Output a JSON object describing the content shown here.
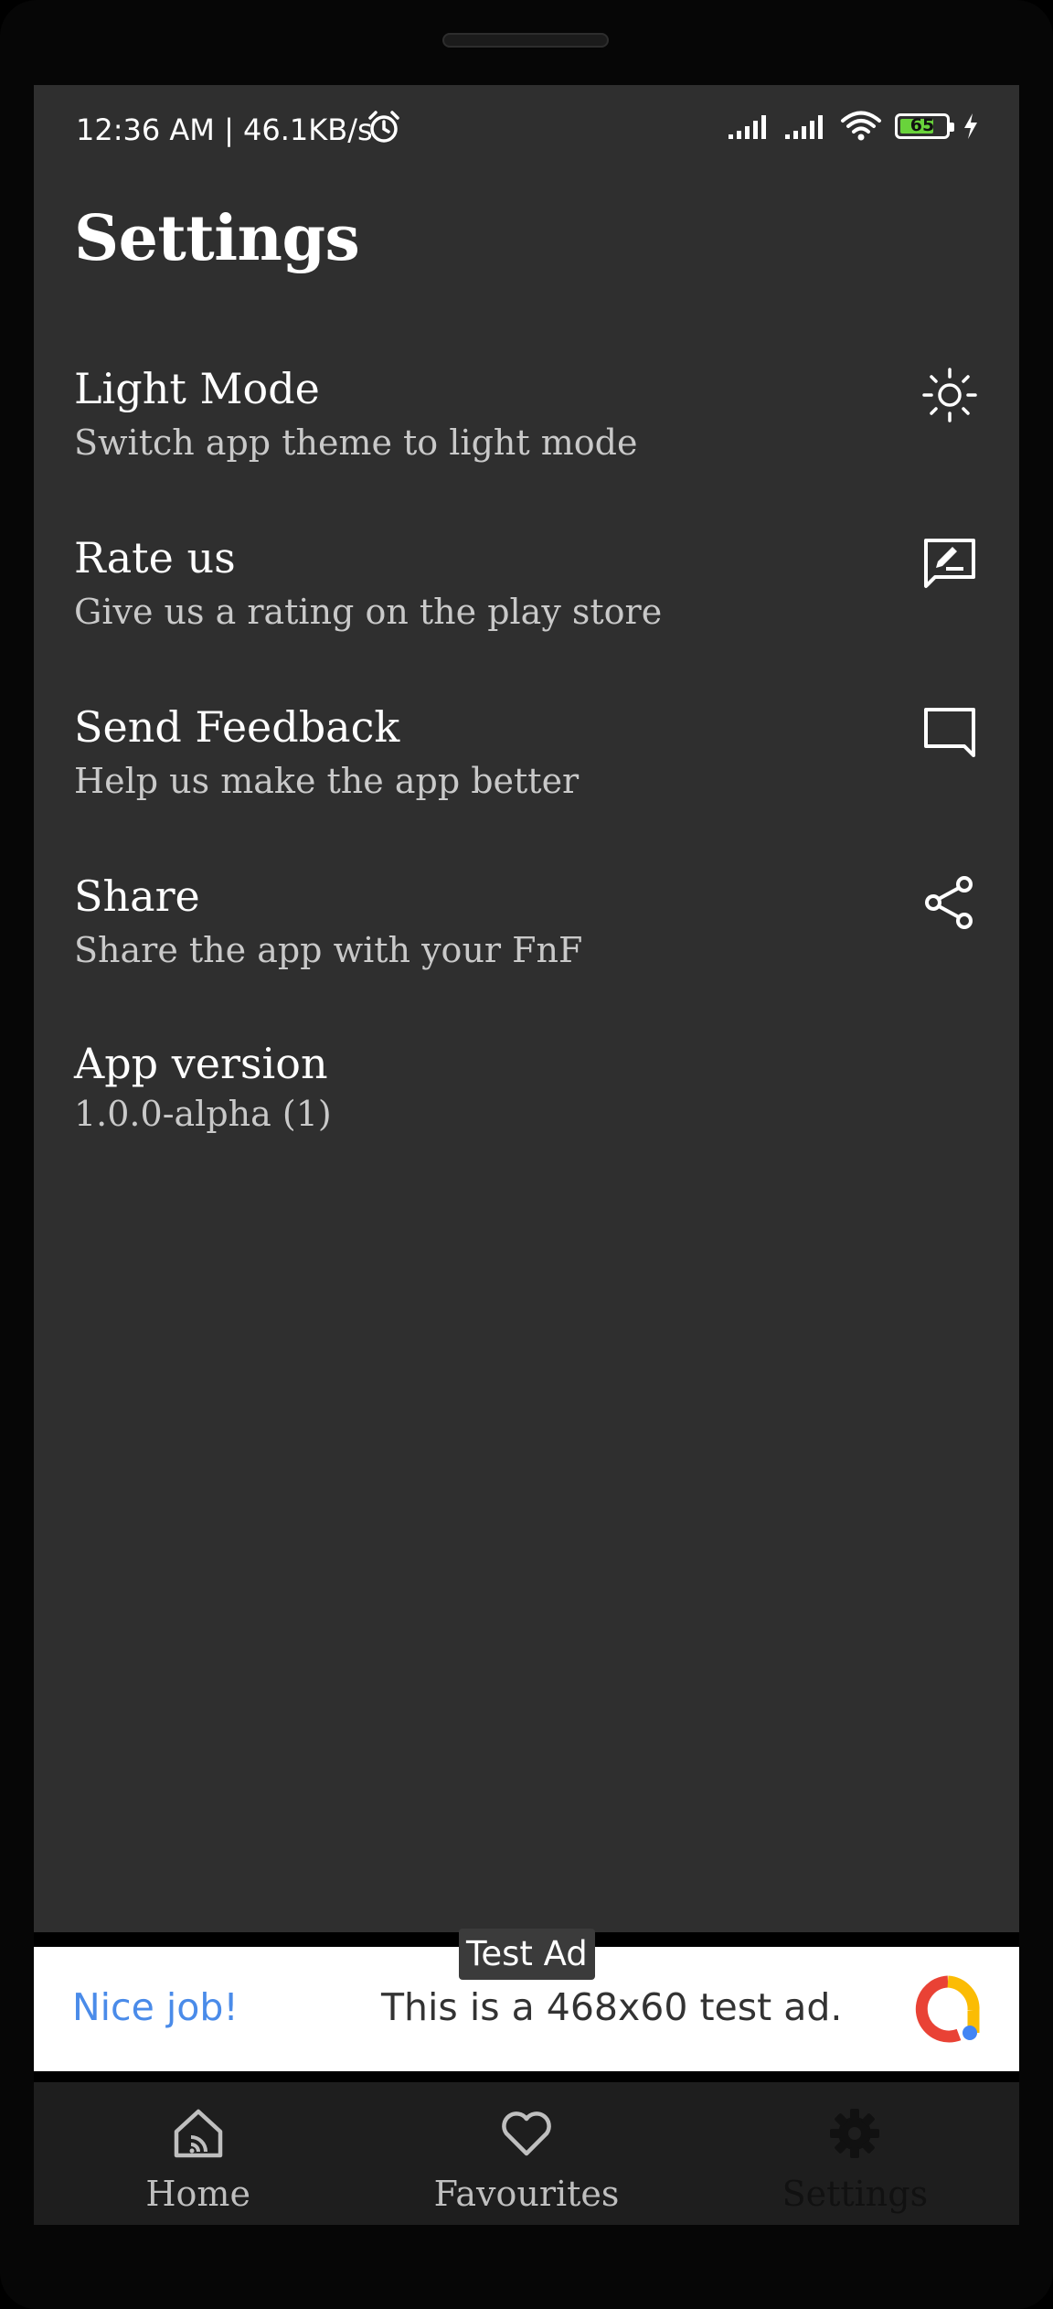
{
  "status_bar": {
    "time": "12:36 AM | 46.1KB/s",
    "battery_level": "65",
    "icons": [
      "alarm-icon",
      "signal-icon",
      "signal-icon",
      "wifi-icon",
      "battery-icon",
      "charging-icon"
    ]
  },
  "page": {
    "title": "Settings"
  },
  "settings": [
    {
      "title": "Light Mode",
      "subtitle": "Switch app theme to light mode",
      "icon": "sun-icon"
    },
    {
      "title": "Rate us",
      "subtitle": "Give us a rating on the play store",
      "icon": "rate-review-icon"
    },
    {
      "title": "Send Feedback",
      "subtitle": "Help us make the app better",
      "icon": "chat-bubble-icon"
    },
    {
      "title": "Share",
      "subtitle": "Share the app with your FnF",
      "icon": "share-icon"
    }
  ],
  "app_version": {
    "title": "App version",
    "value": "1.0.0-alpha (1)"
  },
  "ad": {
    "label": "Test Ad",
    "left_text": "Nice job!",
    "main_text": "This is a 468x60 test ad.",
    "colors": {
      "left_text": "#4a8be9"
    }
  },
  "bottom_nav": {
    "items": [
      {
        "label": "Home",
        "icon": "home-icon"
      },
      {
        "label": "Favourites",
        "icon": "heart-icon"
      },
      {
        "label": "Settings",
        "icon": "gear-icon",
        "active": true
      }
    ]
  },
  "colors": {
    "screen_background": "#2f2f2f",
    "nav_background": "#1e1e1e",
    "battery_fill": "#69d33b"
  }
}
